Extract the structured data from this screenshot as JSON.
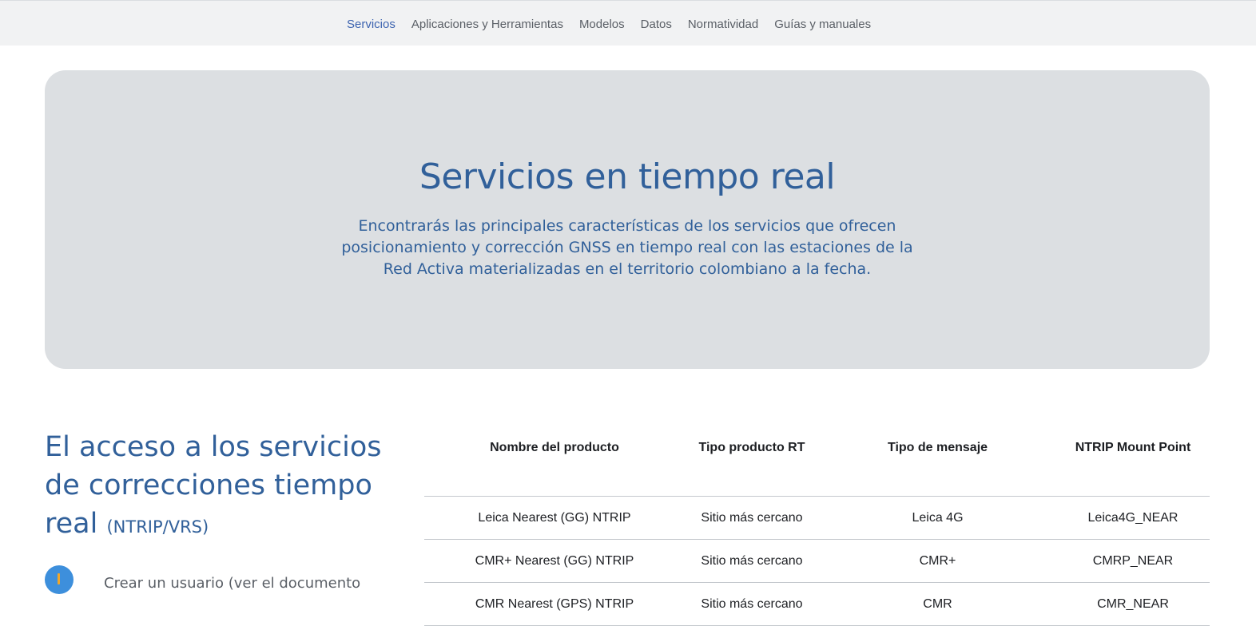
{
  "nav": {
    "items": [
      {
        "label": "Servicios",
        "active": true
      },
      {
        "label": "Aplicaciones y Herramientas",
        "active": false
      },
      {
        "label": "Modelos",
        "active": false
      },
      {
        "label": "Datos",
        "active": false
      },
      {
        "label": "Normatividad",
        "active": false
      },
      {
        "label": "Guías y manuales",
        "active": false
      }
    ]
  },
  "hero": {
    "title": "Servicios en tiempo real",
    "description": "Encontrarás las principales características de los servicios que ofrecen posicionamiento y corrección GNSS en tiempo real con las estaciones de la Red Activa materializadas en el territorio colombiano a la fecha."
  },
  "access": {
    "heading": "El acceso a los servicios de correcciones tiempo real",
    "heading_suffix": "(NTRIP/VRS)",
    "step_text": "Crear un usuario (ver el documento"
  },
  "table": {
    "headers": [
      "Nombre del producto",
      "Tipo producto RT",
      "Tipo de mensaje",
      "NTRIP Mount Point"
    ],
    "rows": [
      [
        "Leica Nearest (GG) NTRIP",
        "Sitio más cercano",
        "Leica 4G",
        "Leica4G_NEAR"
      ],
      [
        "CMR+ Nearest (GG) NTRIP",
        "Sitio más cercano",
        "CMR+",
        "CMRP_NEAR"
      ],
      [
        "CMR Nearest (GPS) NTRIP",
        "Sitio más cercano",
        "CMR",
        "CMR_NEAR"
      ]
    ]
  },
  "colors": {
    "accent": "#31609a",
    "nav_active": "#3d64b0",
    "hero_bg": "#dcdfe2",
    "badge": "#3d8fdc"
  }
}
